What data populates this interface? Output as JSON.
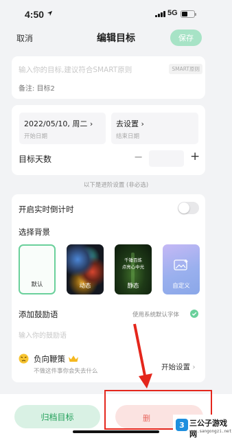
{
  "status_bar": {
    "time": "4:50",
    "network": "5G"
  },
  "nav": {
    "cancel": "取消",
    "title": "编辑目标",
    "save": "保存"
  },
  "goal": {
    "placeholder": "输入你的目标,建议符合SMART原则",
    "smart_badge": "SMART原则",
    "remark": "备注:  目标2"
  },
  "dates": {
    "start_value": "2022/05/10,  周二",
    "start_label": "开始日期",
    "end_value": "去设置",
    "end_label": "结束日期"
  },
  "days": {
    "label": "目标天数",
    "minus": "−",
    "plus": "+"
  },
  "advanced_note": "以下是进阶设置 (非必选)",
  "settings": {
    "countdown_label": "开启实时倒计时",
    "background_label": "选择背景",
    "backgrounds": [
      {
        "label": "默认"
      },
      {
        "label": "动态"
      },
      {
        "label": "静态",
        "lines": [
          "千锤百炼",
          "点亮心中光"
        ]
      },
      {
        "label": "自定义"
      }
    ],
    "encourage_label": "添加鼓励语",
    "system_font": "使用系统默认字体",
    "encourage_placeholder": "输入你的鼓励语",
    "negative_title": "负向鞭策",
    "negative_sub": "不做这件事你会失去什么",
    "start_setup": "开始设置"
  },
  "bottom": {
    "archive": "归档目标",
    "delete_glyph": "删"
  },
  "watermark": {
    "badge": "3",
    "title": "三公子游戏网",
    "url": "www.sangongzi.net"
  },
  "colors": {
    "accent": "#6ad09b",
    "archive_bg": "#d9f1e4",
    "annotation": "#e4261c"
  }
}
